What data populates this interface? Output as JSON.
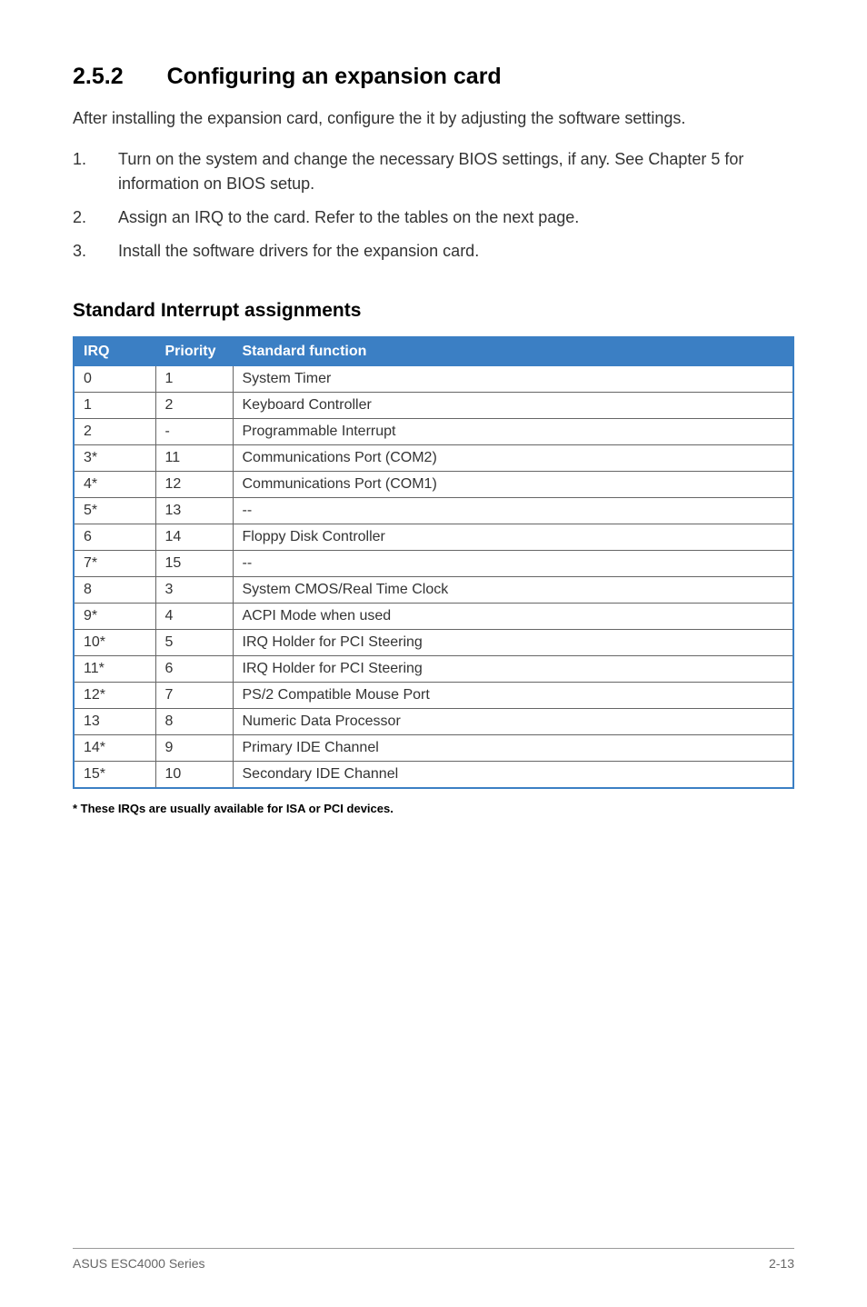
{
  "section": {
    "number": "2.5.2",
    "title": "Configuring an expansion card"
  },
  "intro": "After installing the expansion card, configure the it by adjusting the software settings.",
  "steps": [
    {
      "num": "1.",
      "text": "Turn on the system and change the necessary BIOS settings, if any. See Chapter 5 for information on BIOS setup."
    },
    {
      "num": "2.",
      "text": "Assign an IRQ to the card. Refer to the tables on the next page."
    },
    {
      "num": "3.",
      "text": "Install the software drivers for the expansion card."
    }
  ],
  "tableHeading": "Standard Interrupt assignments",
  "headers": {
    "irq": "IRQ",
    "priority": "Priority",
    "function": "Standard function"
  },
  "rows": [
    {
      "irq": "0",
      "priority": "1",
      "fn": "System Timer"
    },
    {
      "irq": "1",
      "priority": "2",
      "fn": "Keyboard Controller"
    },
    {
      "irq": "2",
      "priority": "-",
      "fn": "Programmable Interrupt"
    },
    {
      "irq": "3*",
      "priority": "11",
      "fn": "Communications Port (COM2)"
    },
    {
      "irq": "4*",
      "priority": "12",
      "fn": "Communications Port (COM1)"
    },
    {
      "irq": "5*",
      "priority": "13",
      "fn": "--"
    },
    {
      "irq": "6",
      "priority": "14",
      "fn": "Floppy Disk Controller"
    },
    {
      "irq": "7*",
      "priority": "15",
      "fn": "--"
    },
    {
      "irq": "8",
      "priority": "3",
      "fn": "System CMOS/Real Time Clock"
    },
    {
      "irq": "9*",
      "priority": "4",
      "fn": "ACPI Mode when used"
    },
    {
      "irq": "10*",
      "priority": "5",
      "fn": "IRQ Holder for PCI Steering"
    },
    {
      "irq": "11*",
      "priority": "6",
      "fn": "IRQ Holder for PCI Steering"
    },
    {
      "irq": "12*",
      "priority": "7",
      "fn": "PS/2 Compatible Mouse Port"
    },
    {
      "irq": "13",
      "priority": "8",
      "fn": "Numeric Data Processor"
    },
    {
      "irq": "14*",
      "priority": "9",
      "fn": "Primary IDE Channel"
    },
    {
      "irq": "15*",
      "priority": "10",
      "fn": "Secondary IDE Channel"
    }
  ],
  "footnote": "* These IRQs are usually available for ISA or PCI devices.",
  "footer": {
    "left": "ASUS ESC4000 Series",
    "right": "2-13"
  }
}
